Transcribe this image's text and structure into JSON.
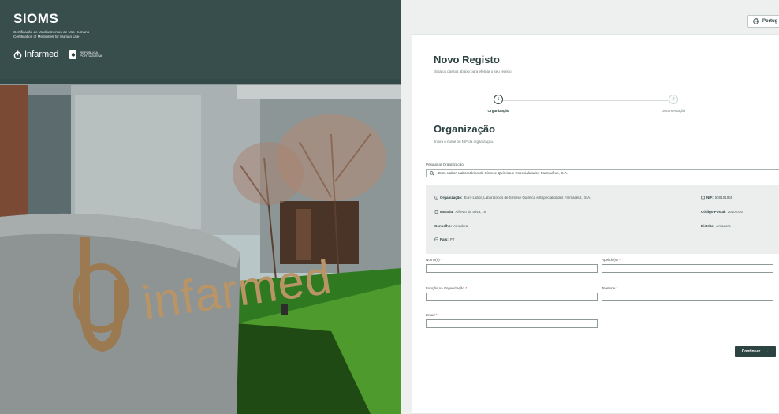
{
  "hero": {
    "brand": "SIOMS",
    "subtitle_line1": "Certificação de Medicamentos de Uso Humano",
    "subtitle_line2": "Certification of Medicines for Human Use",
    "logo_infarmed": "Infarmed",
    "logo_rp_line1": "REPÚBLICA",
    "logo_rp_line2": "PORTUGUESA",
    "photo_sign_text": "infarmed"
  },
  "header": {
    "language_label": "Portug"
  },
  "form": {
    "title": "Novo Registo",
    "subtitle": "Siga os passos abaixo para efetuar o seu registo.",
    "steps": [
      {
        "number": "1",
        "label": "Organização",
        "state": "active"
      },
      {
        "number": "2",
        "label": "Documentação",
        "state": "todo"
      }
    ],
    "section_title": "Organização",
    "section_subtitle": "Insira o nome ou NIF da organização.",
    "search_label": "Pesquisar Organização",
    "search_value": "Euro-Labor, Laboratórios de Síntese Química e Especialidades Farmacêut., S.A.",
    "org_info": {
      "org_label": "Organização:",
      "org_value": "Euro-Labor, Laboratórios de Síntese Química e Especialidades Farmacêut., S.A.",
      "nif_label": "NIF:",
      "nif_value": "500101965",
      "morada_label": "Morada:",
      "morada_value": "Alfredo da Silva, 16",
      "cp_label": "Código Postal:",
      "cp_value": "2610-016",
      "concelho_label": "Concelho:",
      "concelho_value": "Amadora",
      "distrito_label": "Distrito:",
      "distrito_value": "Amadora",
      "pais_label": "País:",
      "pais_value": "PT"
    },
    "fields": {
      "nome_label": "Nome(s)",
      "apelido_label": "Apelido(s)",
      "funcao_label": "Função na Organização",
      "telefone_label": "Telefone",
      "email_label": "Email",
      "required_mark": "*"
    },
    "continue_label": "Continuar",
    "continue_arrow": "→"
  },
  "colors": {
    "primary": "#2c4342",
    "panel_bg": "#eef0f0",
    "info_bg": "#eceeee",
    "required": "#c0392b"
  }
}
